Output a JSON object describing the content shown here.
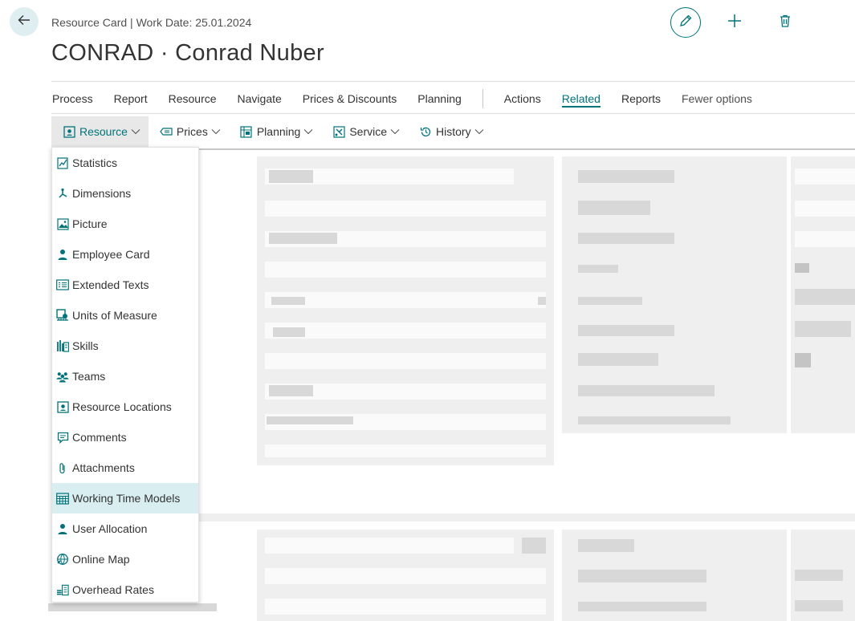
{
  "header": {
    "subtitle": "Resource Card | Work Date: 25.01.2024",
    "title": "CONRAD · Conrad Nuber"
  },
  "menu": {
    "items": [
      {
        "label": "Process"
      },
      {
        "label": "Report"
      },
      {
        "label": "Resource"
      },
      {
        "label": "Navigate"
      },
      {
        "label": "Prices & Discounts"
      },
      {
        "label": "Planning"
      }
    ],
    "items_right": [
      {
        "label": "Actions"
      },
      {
        "label": "Related",
        "active": true
      },
      {
        "label": "Reports"
      },
      {
        "label": "Fewer options"
      }
    ]
  },
  "submenu": {
    "items": [
      {
        "label": "Resource",
        "icon": "resource-icon",
        "open": true
      },
      {
        "label": "Prices",
        "icon": "prices-icon"
      },
      {
        "label": "Planning",
        "icon": "planning-icon"
      },
      {
        "label": "Service",
        "icon": "service-icon"
      },
      {
        "label": "History",
        "icon": "history-icon"
      }
    ]
  },
  "dropdown": {
    "items": [
      {
        "label": "Statistics",
        "icon": "statistics-icon"
      },
      {
        "label": "Dimensions",
        "icon": "dimensions-icon"
      },
      {
        "label": "Picture",
        "icon": "picture-icon"
      },
      {
        "label": "Employee Card",
        "icon": "person-icon"
      },
      {
        "label": "Extended Texts",
        "icon": "text-list-icon"
      },
      {
        "label": "Units of Measure",
        "icon": "units-icon"
      },
      {
        "label": "Skills",
        "icon": "skills-icon"
      },
      {
        "label": "Teams",
        "icon": "teams-icon"
      },
      {
        "label": "Resource Locations",
        "icon": "resource-location-icon"
      },
      {
        "label": "Comments",
        "icon": "comment-icon"
      },
      {
        "label": "Attachments",
        "icon": "paperclip-icon"
      },
      {
        "label": "Working Time Models",
        "icon": "calendar-grid-icon",
        "highlighted": true
      },
      {
        "label": "User Allocation",
        "icon": "person-icon"
      },
      {
        "label": "Online Map",
        "icon": "globe-icon"
      },
      {
        "label": "Overhead Rates",
        "icon": "rates-icon"
      }
    ]
  },
  "colors": {
    "accent": "#00737a",
    "highlight": "#d9eef0"
  }
}
